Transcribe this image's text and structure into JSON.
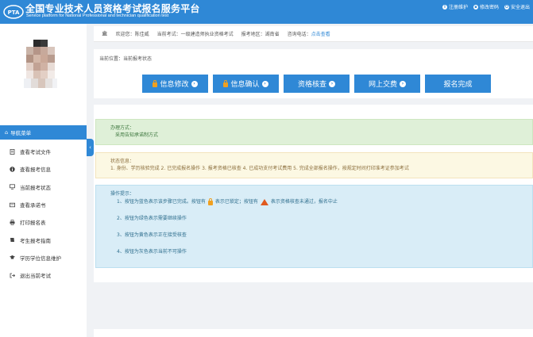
{
  "header": {
    "title_cn": "全国专业技术人员资格考试报名服务平台",
    "title_en": "Service platform for National Professional and technician qualification test",
    "links": [
      {
        "icon": "info-icon",
        "label": "注册维护"
      },
      {
        "icon": "lock-icon",
        "label": "修改密码"
      },
      {
        "icon": "power-icon",
        "label": "安全退出"
      }
    ]
  },
  "sidebar": {
    "nav_head": "导航菜单",
    "items": [
      {
        "icon": "document-icon",
        "label": "查看考试文件"
      },
      {
        "icon": "info-icon",
        "label": "查看报考信息"
      },
      {
        "icon": "monitor-icon",
        "label": "当前报考状态"
      },
      {
        "icon": "card-icon",
        "label": "查看承诺书"
      },
      {
        "icon": "printer-icon",
        "label": "打印报名表"
      },
      {
        "icon": "book-icon",
        "label": "考生报考指南"
      },
      {
        "icon": "graduation-cap-icon",
        "label": "学历学位信息维护"
      },
      {
        "icon": "logout-icon",
        "label": "退出当前考试"
      }
    ]
  },
  "info_bar": {
    "welcome": "欢迎您：陈佳威",
    "exam": "当前考试：一级建造师执业资格考试",
    "region": "报考地区：湖南省",
    "phone_label": "咨询电话：",
    "phone_link": "点击查看"
  },
  "steps": {
    "crumb": "当前位置：当前报考状态",
    "items": [
      {
        "label": "信息修改",
        "locked": true
      },
      {
        "label": "信息确认",
        "locked": true
      },
      {
        "label": "资格核查",
        "locked": false
      },
      {
        "label": "网上交费",
        "locked": false
      },
      {
        "label": "报名完成",
        "locked": false
      }
    ]
  },
  "panels": {
    "method_title": "办理方式：",
    "method_text": "采用告知承诺制方式",
    "status_title": "状态信息：",
    "status_text": "1. 身份、学历核验完成 2. 已完成报名操作 3. 报考资格已核查 4. 已成功支付考试费用 5. 完成全部报名操作，按规定时间打印准考证参加考试",
    "tips_title": "操作提示：",
    "tip1_a": "1、按钮为蓝色表示该步骤已完成。按钮有",
    "tip1_b": "表示已锁定；按钮有",
    "tip1_c": "表示资格核查未通过，报名中止",
    "tip2": "2、按钮为绿色表示需要继续操作",
    "tip3": "3、按钮为黄色表示正在接受核查",
    "tip4": "4、按钮为灰色表示当前不可操作"
  },
  "colors": {
    "primary": "#2f88d6",
    "lock": "#f0a020",
    "warning": "#e05a1e"
  }
}
